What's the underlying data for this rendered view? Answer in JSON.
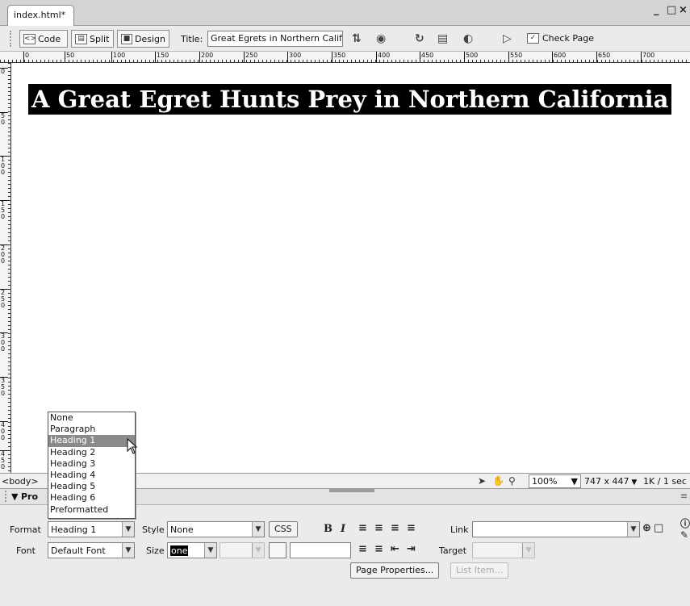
{
  "doc_tab": {
    "label": "index.html*"
  },
  "window_controls": {
    "minimize": "_",
    "restore": "□",
    "close": "×"
  },
  "toolbar": {
    "code_label": "Code",
    "split_label": "Split",
    "design_label": "Design",
    "title_label": "Title:",
    "title_value": "Great Egrets in Northern Califc",
    "check_page_label": "Check Page"
  },
  "ruler": {
    "h_ticks": [
      "0",
      "50",
      "100",
      "150",
      "200",
      "250",
      "300",
      "350",
      "400",
      "450",
      "500",
      "550",
      "600",
      "650",
      "700"
    ],
    "v_ticks": [
      "0",
      "50",
      "100",
      "150",
      "200",
      "250",
      "300",
      "350",
      "400",
      "450"
    ]
  },
  "canvas": {
    "heading": "A Great Egret Hunts Prey in Northern California"
  },
  "status": {
    "tag": "<body>",
    "zoom": "100%",
    "dimensions": "747 x 447",
    "size_time": "1K / 1 sec"
  },
  "properties": {
    "panel_title": "Pro",
    "format_label": "Format",
    "format_value": "Heading 1",
    "style_label": "Style",
    "style_value": "None",
    "css_label": "CSS",
    "bold_label": "B",
    "italic_label": "I",
    "link_label": "Link",
    "font_label": "Font",
    "font_value": "Default Font",
    "size_label": "Size",
    "size_value": "one",
    "target_label": "Target",
    "page_properties_label": "Page Properties...",
    "list_item_label": "List Item..."
  },
  "format_dropdown": {
    "options": [
      "None",
      "Paragraph",
      "Heading 1",
      "Heading 2",
      "Heading 3",
      "Heading 4",
      "Heading 5",
      "Heading 6",
      "Preformatted"
    ],
    "selected": "Heading 1"
  }
}
